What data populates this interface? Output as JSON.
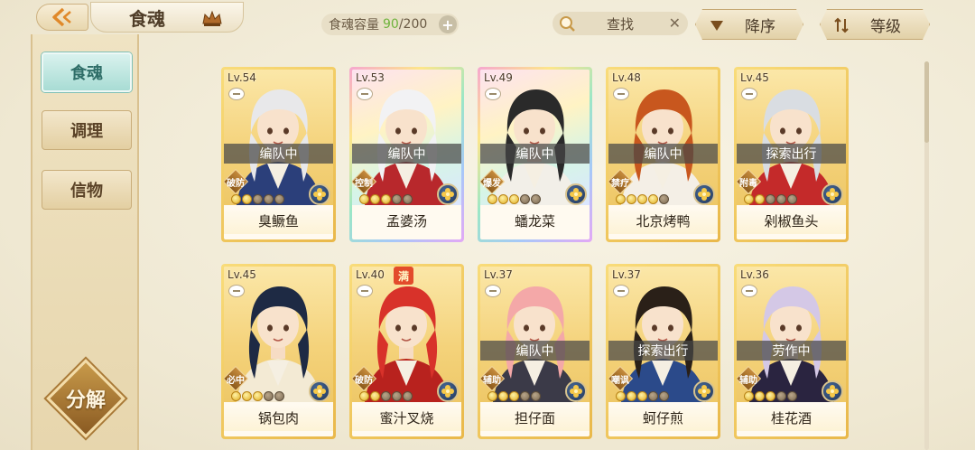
{
  "header": {
    "title": "食魂",
    "capacity_label": "食魂容量",
    "capacity_current": "90",
    "capacity_total": "/200",
    "search_placeholder": "查找",
    "sort_order_label": "降序",
    "sort_key_label": "等级"
  },
  "sidebar": {
    "items": [
      {
        "label": "食魂",
        "active": true
      },
      {
        "label": "调理",
        "active": false
      },
      {
        "label": "信物",
        "active": false
      }
    ],
    "decompose_label": "分解"
  },
  "cards": [
    {
      "level": "Lv.54",
      "name": "臭鳜鱼",
      "status": "编队中",
      "role": "破防",
      "stars_on": 2,
      "stars_total": 5,
      "frame": "gold",
      "hair": "#e8e8ea",
      "outfit": "#2b3f7a",
      "man": ""
    },
    {
      "level": "Lv.53",
      "name": "孟婆汤",
      "status": "编队中",
      "role": "控制",
      "stars_on": 3,
      "stars_total": 5,
      "frame": "rainbow",
      "hair": "#f2f2f4",
      "outfit": "#b8282c",
      "man": ""
    },
    {
      "level": "Lv.49",
      "name": "蟠龙菜",
      "status": "编队中",
      "role": "爆发",
      "stars_on": 3,
      "stars_total": 5,
      "frame": "rainbow",
      "hair": "#2a2a2a",
      "outfit": "#f2efe8",
      "man": ""
    },
    {
      "level": "Lv.48",
      "name": "北京烤鸭",
      "status": "编队中",
      "role": "禁疗",
      "stars_on": 4,
      "stars_total": 5,
      "frame": "gold",
      "hair": "#c8571e",
      "outfit": "#f4efe6",
      "man": ""
    },
    {
      "level": "Lv.45",
      "name": "剁椒鱼头",
      "status": "探索出行",
      "role": "附毒",
      "stars_on": 2,
      "stars_total": 5,
      "frame": "gold",
      "hair": "#d9dde2",
      "outfit": "#c42a2a",
      "man": ""
    },
    {
      "level": "Lv.45",
      "name": "锅包肉",
      "status": "",
      "role": "必中",
      "stars_on": 3,
      "stars_total": 5,
      "frame": "gold",
      "hair": "#1e2a44",
      "outfit": "#f3ead4",
      "man": ""
    },
    {
      "level": "Lv.40",
      "name": "蜜汁叉烧",
      "status": "",
      "role": "破防",
      "stars_on": 2,
      "stars_total": 5,
      "frame": "gold",
      "hair": "#d8322a",
      "outfit": "#b8221e",
      "man": "满"
    },
    {
      "level": "Lv.37",
      "name": "担仔面",
      "status": "编队中",
      "role": "辅助",
      "stars_on": 3,
      "stars_total": 5,
      "frame": "gold",
      "hair": "#f4a8a8",
      "outfit": "#3b3a48",
      "man": ""
    },
    {
      "level": "Lv.37",
      "name": "蚵仔煎",
      "status": "探索出行",
      "role": "嘲讽",
      "stars_on": 3,
      "stars_total": 5,
      "frame": "gold",
      "hair": "#2a2018",
      "outfit": "#2b4a8a",
      "man": ""
    },
    {
      "level": "Lv.36",
      "name": "桂花酒",
      "status": "劳作中",
      "role": "辅助",
      "stars_on": 3,
      "stars_total": 5,
      "frame": "gold",
      "hair": "#d4c8e6",
      "outfit": "#2a2440",
      "man": ""
    }
  ]
}
